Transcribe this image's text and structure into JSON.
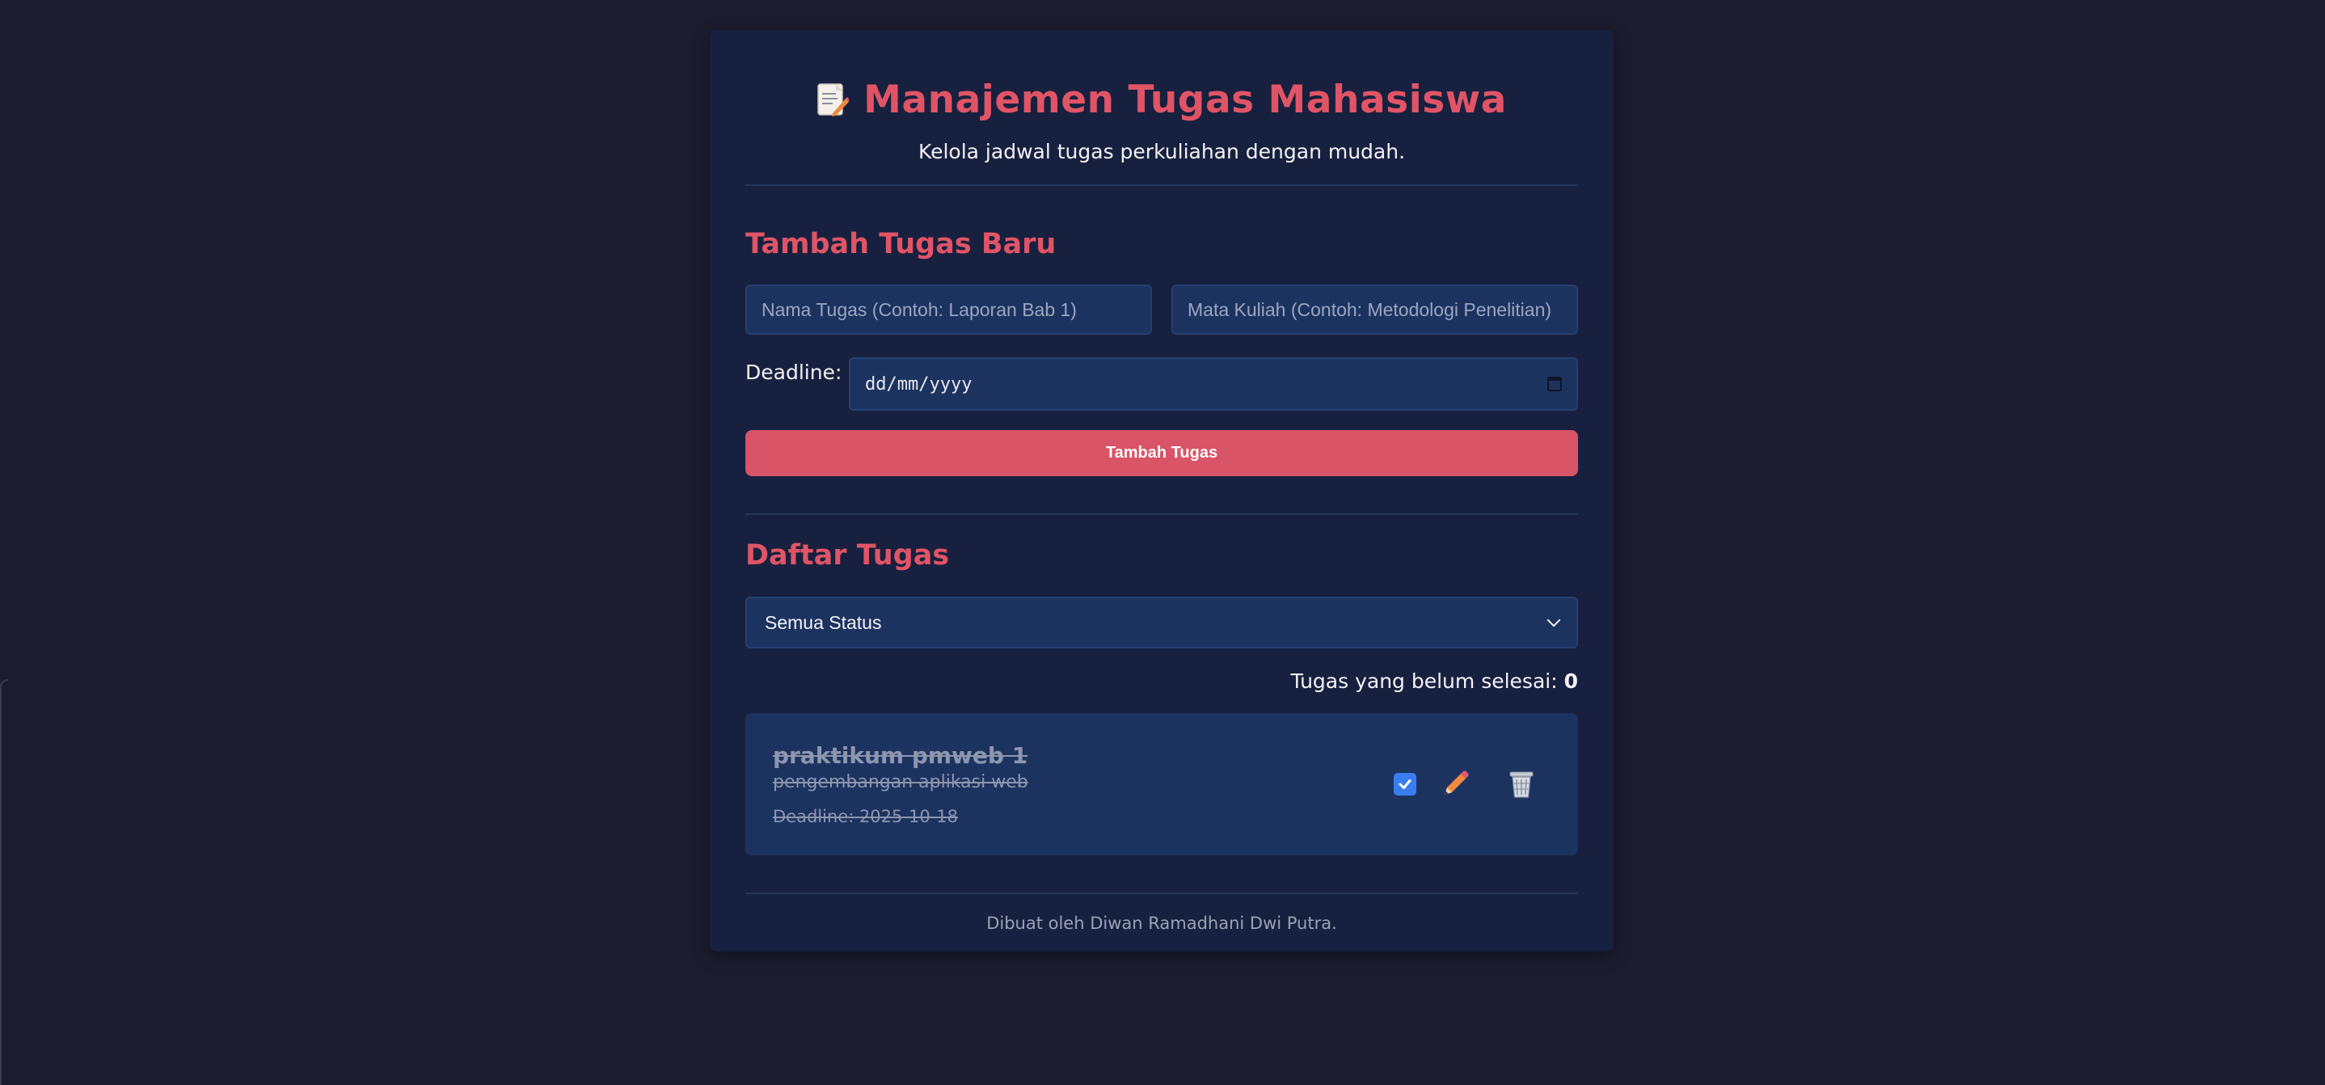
{
  "header": {
    "title": "Manajemen Tugas Mahasiswa",
    "subtitle": "Kelola jadwal tugas perkuliahan dengan mudah.",
    "icon": "memo-icon"
  },
  "add_form": {
    "section_title": "Tambah Tugas Baru",
    "task_name": {
      "value": "",
      "placeholder": "Nama Tugas (Contoh: Laporan Bab 1)"
    },
    "course": {
      "value": "",
      "placeholder": "Mata Kuliah (Contoh: Metodologi Penelitian)"
    },
    "deadline_label": "Deadline:",
    "deadline_value": "dd/mm/yyyy",
    "submit_label": "Tambah Tugas"
  },
  "task_list": {
    "section_title": "Daftar Tugas",
    "filter_selected": "Semua Status",
    "counter_label": "Tugas yang belum selesai:",
    "counter_value": "0",
    "items": [
      {
        "name": "praktikum pmweb 1",
        "course": "pengembangan aplikasi web",
        "deadline": "Deadline: 2025-10-18",
        "done": true
      }
    ]
  },
  "footer": {
    "text": "Dibuat oleh Diwan Ramadhani Dwi Putra."
  },
  "colors": {
    "background": "#1b1c2e",
    "card": "#17213f",
    "accent": "#e05466",
    "input": "#1c3360",
    "checkbox": "#3a7df0"
  }
}
